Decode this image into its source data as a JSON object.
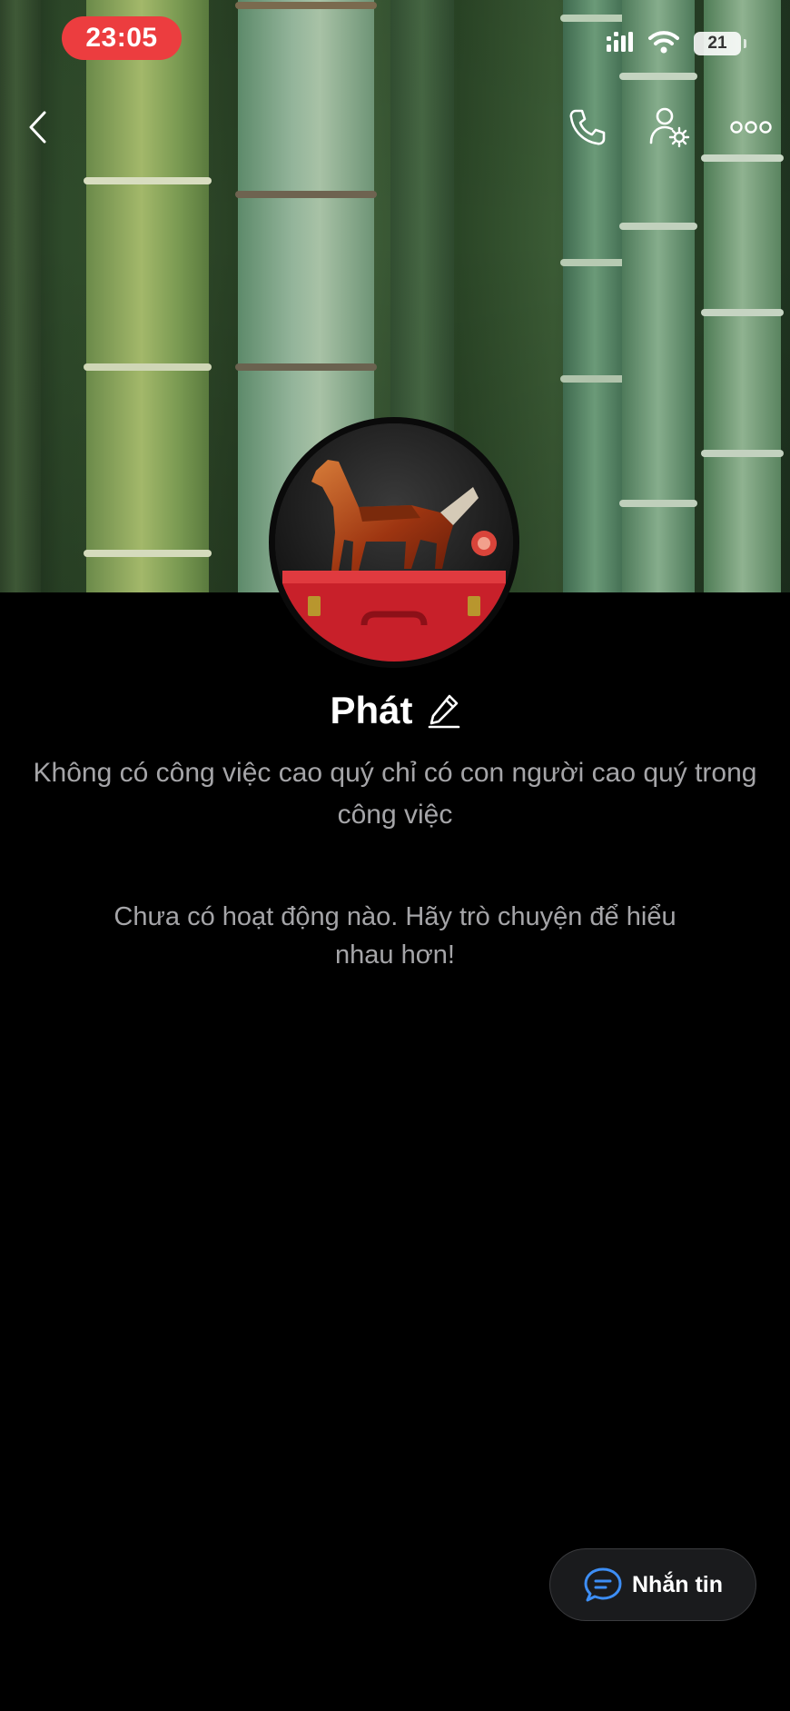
{
  "status_bar": {
    "time": "23:05",
    "battery_level": "21",
    "signal_icon": "cellular-signal-icon",
    "wifi_icon": "wifi-icon"
  },
  "nav": {
    "back_icon": "chevron-left-icon",
    "call_icon": "phone-icon",
    "settings_icon": "user-settings-icon",
    "more_icon": "more-dots-icon"
  },
  "profile": {
    "name": "Phát",
    "edit_icon": "pencil-icon",
    "bio": "Không có công việc cao quý chỉ có con người cao quý trong công việc",
    "empty_activity": "Chưa có hoạt động nào. Hãy trò chuyện để hiểu nhau hơn!"
  },
  "actions": {
    "message_label": "Nhắn tin",
    "message_icon": "chat-bubble-icon"
  },
  "colors": {
    "time_pill": "#ec3d3f",
    "background": "#000000",
    "secondary_text": "#a5a5a8",
    "accent_blue": "#3d8ef5"
  }
}
